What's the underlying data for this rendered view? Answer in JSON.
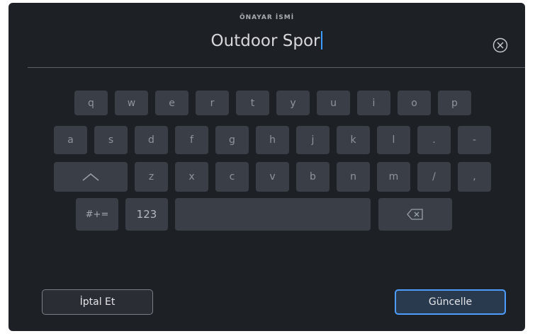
{
  "dialog": {
    "title": "ÖNAYAR İSMİ",
    "name_value": "Outdoor Spor",
    "clear_icon": "circle-x-icon"
  },
  "keyboard": {
    "row1": [
      "q",
      "w",
      "e",
      "r",
      "t",
      "y",
      "u",
      "i",
      "o",
      "p"
    ],
    "row2": [
      "a",
      "s",
      "d",
      "f",
      "g",
      "h",
      "j",
      "k",
      "l",
      ".",
      "-"
    ],
    "row3": [
      "z",
      "x",
      "c",
      "v",
      "b",
      "n",
      "m",
      "/",
      ","
    ],
    "shift_icon": "shift-chevron-icon",
    "symbols_label": "#+=",
    "numbers_label": "123",
    "backspace_icon": "backspace-icon"
  },
  "actions": {
    "cancel_label": "İptal Et",
    "update_label": "Güncelle"
  },
  "colors": {
    "background": "#1d2025",
    "key": "#3a3f47",
    "accent": "#4d9dff",
    "caret": "#3b9bff"
  }
}
